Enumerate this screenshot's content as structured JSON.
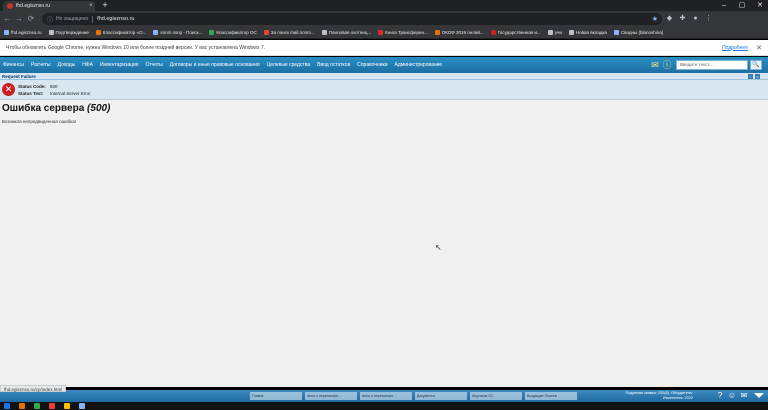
{
  "browser": {
    "tab_title": "fhd.egisznso.ru",
    "tab_close": "×",
    "new_tab": "+",
    "security_label": "Не защищено",
    "url": "fhd.egisznso.ru",
    "back": "←",
    "forward": "→",
    "reload": "⟳",
    "lock": "ⓘ",
    "star": "★",
    "min": "–",
    "max": "▢",
    "close": "✕"
  },
  "bookmarks": [
    {
      "label": "fhd.egisznso.ru",
      "color": "#8ab4f8"
    },
    {
      "label": "Подтверждение",
      "color": "#bdc1c6"
    },
    {
      "label": "Классификатор «О...",
      "color": "#e37400"
    },
    {
      "label": "sonm ssnp - Поиск...",
      "color": "#8ab4f8"
    },
    {
      "label": "Классификатор ОС",
      "color": "#34a853"
    },
    {
      "label": "За поиск mail.nonm...",
      "color": "#ea4335"
    },
    {
      "label": "Поиловая охотниц...",
      "color": "#bdc1c6"
    },
    {
      "label": "Книга Трансферен...",
      "color": "#d93025"
    },
    {
      "label": "ОКОФ 2019 онлай...",
      "color": "#e37400"
    },
    {
      "label": "Государственная и...",
      "color": "#c5221f"
    },
    {
      "label": "учи",
      "color": "#bdc1c6"
    },
    {
      "label": "Новая вкладка",
      "color": "#bdc1c6"
    },
    {
      "label": "Сводны (blanovhina)",
      "color": "#8ab4f8"
    }
  ],
  "infobar": {
    "message": "Чтобы обновлять Google Chrome, нужна Windows 10 или более поздней версии. У вас установлена Windows 7.",
    "more_link": "Подробнее",
    "close": "✕"
  },
  "appmenu": {
    "items": [
      "Финансы",
      "Расчеты",
      "Доходы",
      "НФА",
      "Инвентаризация",
      "Отчеты",
      "Договоры и иные правовые основания",
      "Целевые средства",
      "Ввод остатков",
      "Справочники",
      "Администрирование"
    ],
    "search_placeholder": "Введите текст...",
    "search_button": "🔍",
    "icon_mail": "✉",
    "icon_info": "ⓘ"
  },
  "error": {
    "header": "Request Failure",
    "icon": "✕",
    "status_code_label": "Status Code:",
    "status_code_value": "500",
    "status_text_label": "Status Text:",
    "status_text_value": "Internal Server Error",
    "title": "Ошибка сервера",
    "code": "(500)",
    "message": "Возникла непредвиденная ошибка!"
  },
  "status_url": "fhd.egisznso.ru/cp/index.html",
  "bottom_tabs": [
    "Главна",
    "Акты о пересмотре...",
    "Акты о пересмотре...",
    "Документы",
    "Журналы ОС",
    "Входящие Платеж"
  ],
  "bottom_info": {
    "line1": "Поданная заявка: 152(8), Обсудитель:",
    "line2": "Изменения: 2022"
  },
  "bottom_icons": [
    "?",
    "☺",
    "✉"
  ]
}
